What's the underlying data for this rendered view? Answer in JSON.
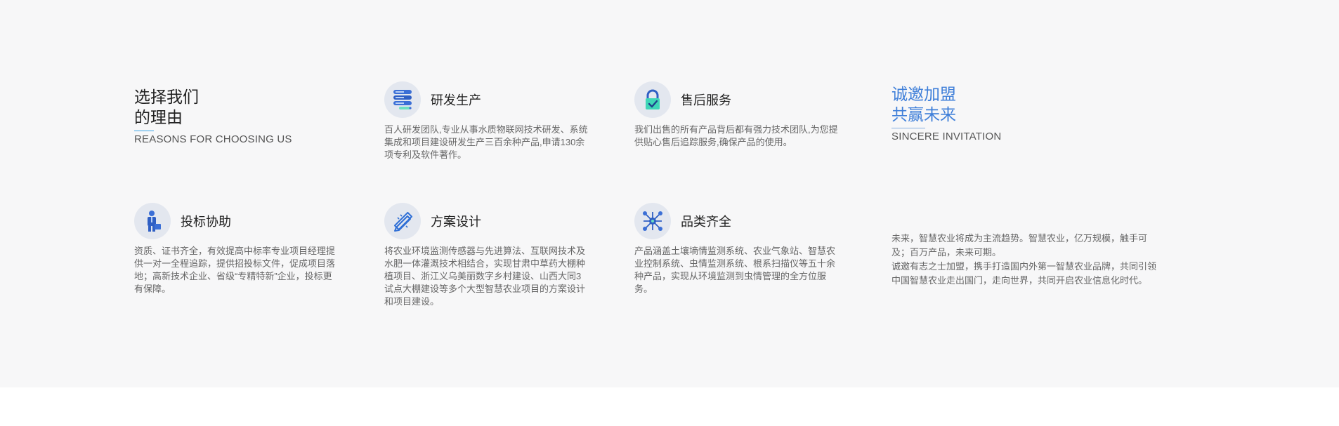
{
  "reasons": {
    "title_line1": "选择我们",
    "title_line2": "的理由",
    "subtitle": "REASONS FOR CHOOSING US"
  },
  "invitation": {
    "title_line1": "诚邀加盟",
    "title_line2": "共赢未来",
    "subtitle": "SINCERE INVITATION",
    "paragraph1": "未来，智慧农业将成为主流趋势。智慧农业，亿万规模，触手可及；百万产品，未来可期。",
    "paragraph2": "诚邀有志之士加盟，携手打造国内外第一智慧农业品牌，共同引领中国智慧农业走出国门，走向世界，共同开启农业信息化时代。"
  },
  "cards": [
    {
      "icon": "server-icon",
      "title": "研发生产",
      "desc": "百人研发团队,专业从事水质物联网技术研发、系统集成和项目建设研发生产三百余种产品,申请130余项专利及软件著作。"
    },
    {
      "icon": "lock-icon",
      "title": "售后服务",
      "desc": "我们出售的所有产品背后都有强力技术团队,为您提供贴心售后追踪服务,确保产品的使用。"
    },
    {
      "icon": "businessman-icon",
      "title": "投标协助",
      "desc": "资质、证书齐全，有效提高中标率专业项目经理提供一对一全程追踪，提供招投标文件，促成项目落地；高新技术企业、省级“专精特新”企业，投标更有保障。"
    },
    {
      "icon": "pencil-ruler-icon",
      "title": "方案设计",
      "desc": "将农业环境监测传感器与先进算法、互联网技术及水肥一体灌溉技术相结合，实现甘肃中草药大棚种植项目、浙江义乌美丽数字乡村建设、山西大同3试点大棚建设等多个大型智慧农业项目的方案设计和项目建设。"
    },
    {
      "icon": "network-icon",
      "title": "品类齐全",
      "desc": "产品涵盖土壤墒情监测系统、农业气象站、智慧农业控制系统、虫情监测系统、根系扫描仪等五十余种产品，实现从环境监测到虫情管理的全方位服务。"
    }
  ],
  "colors": {
    "band_background": "#f7f7f8",
    "invitation_accent": "#3f7fd9",
    "icon_circle": "#e3e7ef"
  }
}
